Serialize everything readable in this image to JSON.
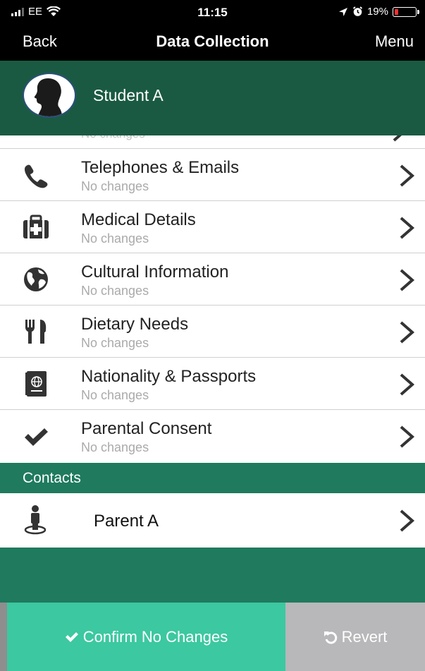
{
  "status_bar": {
    "carrier": "EE",
    "time": "11:15",
    "battery": "19%",
    "battery_level": 0.19,
    "icons": [
      "signal-icon",
      "wifi-icon",
      "location-icon",
      "alarm-icon",
      "battery-icon"
    ]
  },
  "nav": {
    "back": "Back",
    "title": "Data Collection",
    "menu": "Menu"
  },
  "student": {
    "name": "Student A",
    "avatar_icon": "person-silhouette-icon"
  },
  "partial_row": {
    "subtitle": "No changes"
  },
  "items": [
    {
      "title": "Telephones & Emails",
      "subtitle": "No changes",
      "icon": "telephone-icon"
    },
    {
      "title": "Medical Details",
      "subtitle": "No changes",
      "icon": "medical-kit-icon"
    },
    {
      "title": "Cultural Information",
      "subtitle": "No changes",
      "icon": "globe-icon"
    },
    {
      "title": "Dietary Needs",
      "subtitle": "No changes",
      "icon": "fork-knife-icon"
    },
    {
      "title": "Nationality & Passports",
      "subtitle": "No changes",
      "icon": "passport-icon"
    },
    {
      "title": "Parental Consent",
      "subtitle": "No changes",
      "icon": "checkmark-icon"
    }
  ],
  "contacts": {
    "section_label": "Contacts",
    "items": [
      {
        "name": "Parent A",
        "icon": "person-pin-icon"
      }
    ]
  },
  "actions": {
    "confirm": "Confirm No Changes",
    "revert": "Revert"
  },
  "colors": {
    "header_green": "#1a5a43",
    "section_green": "#1f7a5e",
    "confirm_green": "#3cc8a0",
    "revert_gray": "#b8b7b9"
  }
}
